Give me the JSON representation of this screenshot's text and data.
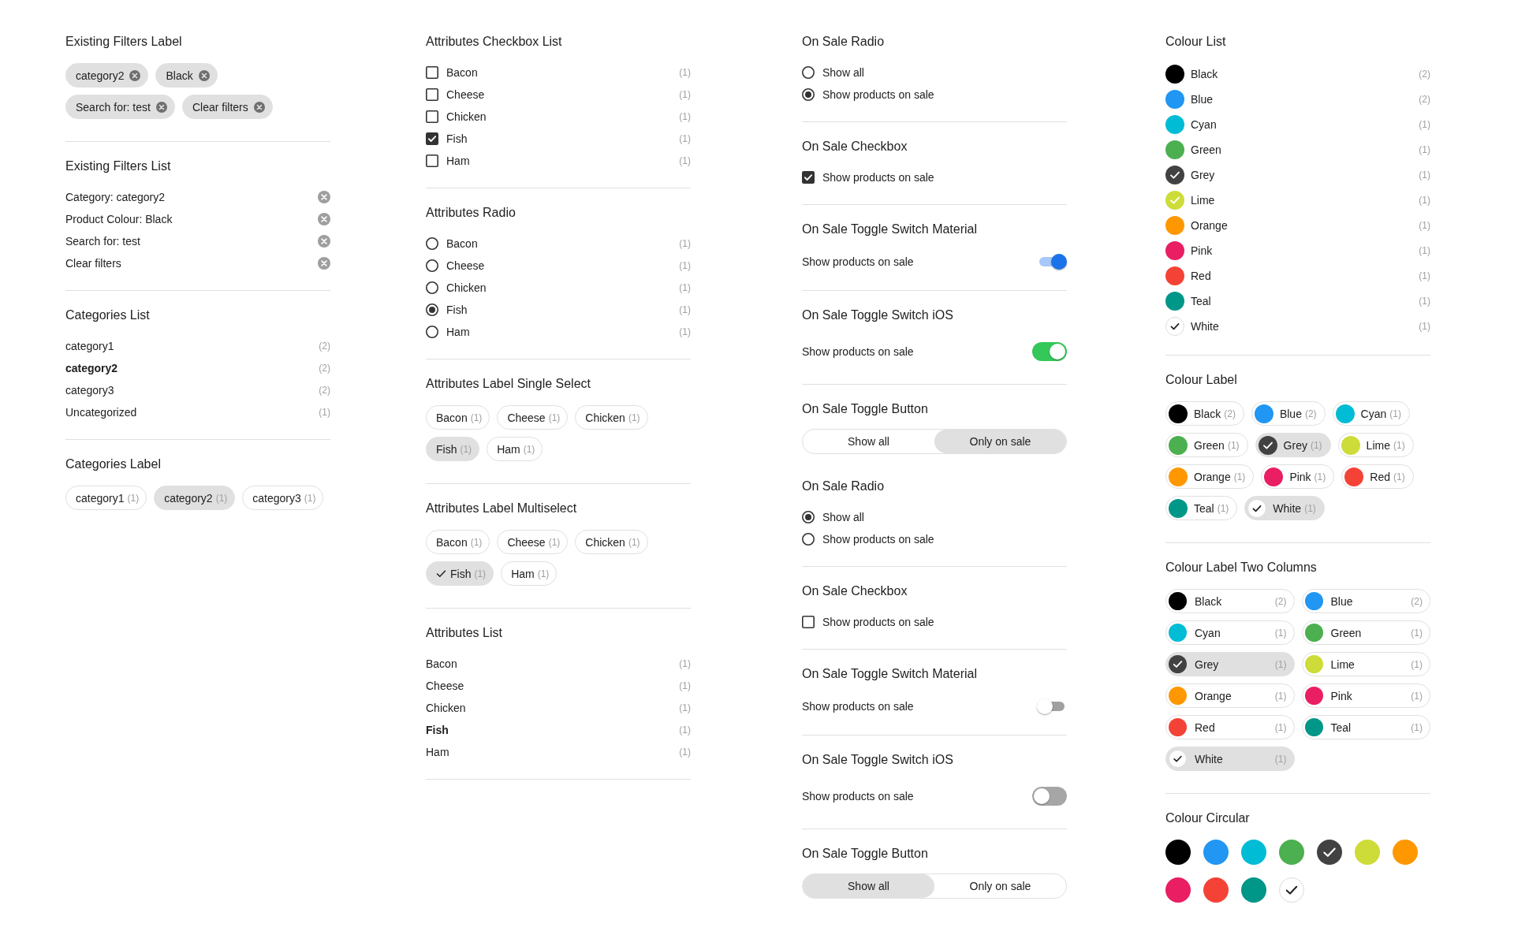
{
  "columns": [
    {
      "sections": [
        {
          "kind": "tags",
          "title": "Existing Filters Label",
          "divider": true,
          "chips": [
            {
              "label": "category2"
            },
            {
              "label": "Black"
            },
            {
              "label": "Search for: test"
            },
            {
              "label": "Clear filters"
            }
          ]
        },
        {
          "kind": "removals",
          "title": "Existing Filters List",
          "divider": true,
          "items": [
            {
              "label": "Category: category2"
            },
            {
              "label": "Product Colour: Black"
            },
            {
              "label": "Search for: test"
            },
            {
              "label": "Clear filters"
            }
          ]
        },
        {
          "kind": "links",
          "title": "Categories List",
          "divider": true,
          "items": [
            {
              "label": "category1",
              "count": "(2)",
              "selected": false
            },
            {
              "label": "category2",
              "count": "(2)",
              "selected": true
            },
            {
              "label": "category3",
              "count": "(2)",
              "selected": false
            },
            {
              "label": "Uncategorized",
              "count": "(1)",
              "selected": false
            }
          ]
        },
        {
          "kind": "pills",
          "title": "Categories Label",
          "divider": false,
          "chips": [
            {
              "label": "category1",
              "count": "(1)",
              "selected": false
            },
            {
              "label": "category2",
              "count": "(1)",
              "selected": true
            },
            {
              "label": "category3",
              "count": "(1)",
              "selected": false
            }
          ]
        }
      ]
    },
    {
      "sections": [
        {
          "kind": "checkboxes",
          "title": "Attributes Checkbox List",
          "divider": true,
          "items": [
            {
              "label": "Bacon",
              "count": "(1)",
              "checked": false
            },
            {
              "label": "Cheese",
              "count": "(1)",
              "checked": false
            },
            {
              "label": "Chicken",
              "count": "(1)",
              "checked": false
            },
            {
              "label": "Fish",
              "count": "(1)",
              "checked": true
            },
            {
              "label": "Ham",
              "count": "(1)",
              "checked": false
            }
          ]
        },
        {
          "kind": "radios",
          "title": "Attributes Radio",
          "divider": true,
          "items": [
            {
              "label": "Bacon",
              "count": "(1)",
              "selected": false
            },
            {
              "label": "Cheese",
              "count": "(1)",
              "selected": false
            },
            {
              "label": "Chicken",
              "count": "(1)",
              "selected": false
            },
            {
              "label": "Fish",
              "count": "(1)",
              "selected": true
            },
            {
              "label": "Ham",
              "count": "(1)",
              "selected": false
            }
          ]
        },
        {
          "kind": "pills",
          "title": "Attributes Label Single Select",
          "divider": true,
          "chips": [
            {
              "label": "Bacon",
              "count": "(1)",
              "selected": false
            },
            {
              "label": "Cheese",
              "count": "(1)",
              "selected": false
            },
            {
              "label": "Chicken",
              "count": "(1)",
              "selected": false
            },
            {
              "label": "Fish",
              "count": "(1)",
              "selected": true
            },
            {
              "label": "Ham",
              "count": "(1)",
              "selected": false
            }
          ]
        },
        {
          "kind": "checkpills",
          "title": "Attributes Label Multiselect",
          "divider": true,
          "chips": [
            {
              "label": "Bacon",
              "count": "(1)",
              "selected": false
            },
            {
              "label": "Cheese",
              "count": "(1)",
              "selected": false
            },
            {
              "label": "Chicken",
              "count": "(1)",
              "selected": false
            },
            {
              "label": "Fish",
              "count": "(1)",
              "selected": true
            },
            {
              "label": "Ham",
              "count": "(1)",
              "selected": false
            }
          ]
        },
        {
          "kind": "links",
          "title": "Attributes List",
          "divider": true,
          "items": [
            {
              "label": "Bacon",
              "count": "(1)",
              "selected": false
            },
            {
              "label": "Cheese",
              "count": "(1)",
              "selected": false
            },
            {
              "label": "Chicken",
              "count": "(1)",
              "selected": false
            },
            {
              "label": "Fish",
              "count": "(1)",
              "selected": true
            },
            {
              "label": "Ham",
              "count": "(1)",
              "selected": false
            }
          ]
        }
      ]
    },
    {
      "sections": [
        {
          "kind": "radios",
          "title": "On Sale Radio",
          "divider": true,
          "items": [
            {
              "label": "Show all",
              "selected": false
            },
            {
              "label": "Show products on sale",
              "selected": true
            }
          ]
        },
        {
          "kind": "checkboxes",
          "title": "On Sale Checkbox",
          "divider": true,
          "items": [
            {
              "label": "Show products on sale",
              "checked": true
            }
          ]
        },
        {
          "kind": "material",
          "title": "On Sale Toggle Switch Material",
          "divider": true,
          "label": "Show products on sale",
          "on": true
        },
        {
          "kind": "ios",
          "title": "On Sale Toggle Switch iOS",
          "divider": true,
          "label": "Show products on sale",
          "on": true
        },
        {
          "kind": "segments",
          "title": "On Sale Toggle Button",
          "divider": false,
          "options": [
            {
              "label": "Show all",
              "selected": false
            },
            {
              "label": "Only on sale",
              "selected": true
            }
          ]
        },
        {
          "kind": "radios",
          "title": "On Sale Radio",
          "divider": true,
          "items": [
            {
              "label": "Show all",
              "selected": true
            },
            {
              "label": "Show products on sale",
              "selected": false
            }
          ]
        },
        {
          "kind": "checkboxes",
          "title": "On Sale Checkbox",
          "divider": true,
          "items": [
            {
              "label": "Show products on sale",
              "checked": false
            }
          ]
        },
        {
          "kind": "material",
          "title": "On Sale Toggle Switch Material",
          "divider": true,
          "label": "Show products on sale",
          "on": false
        },
        {
          "kind": "ios",
          "title": "On Sale Toggle Switch iOS",
          "divider": true,
          "label": "Show products on sale",
          "on": false
        },
        {
          "kind": "segments",
          "title": "On Sale Toggle Button",
          "divider": false,
          "options": [
            {
              "label": "Show all",
              "selected": true
            },
            {
              "label": "Only on sale",
              "selected": false
            }
          ]
        }
      ]
    },
    {
      "sections": [
        {
          "kind": "swatchlist",
          "title": "Colour List",
          "divider": true,
          "items": [
            {
              "label": "Black",
              "count": "(2)",
              "color": "#000000",
              "selected": false
            },
            {
              "label": "Blue",
              "count": "(2)",
              "color": "#2196f3",
              "selected": false
            },
            {
              "label": "Cyan",
              "count": "(1)",
              "color": "#00bcd4",
              "selected": false
            },
            {
              "label": "Green",
              "count": "(1)",
              "color": "#4caf50",
              "selected": false
            },
            {
              "label": "Grey",
              "count": "(1)",
              "color": "#424242",
              "selected": true
            },
            {
              "label": "Lime",
              "count": "(1)",
              "color": "#cddc39",
              "selected": true
            },
            {
              "label": "Orange",
              "count": "(1)",
              "color": "#ff9800",
              "selected": false
            },
            {
              "label": "Pink",
              "count": "(1)",
              "color": "#e91e63",
              "selected": false
            },
            {
              "label": "Red",
              "count": "(1)",
              "color": "#f44336",
              "selected": false
            },
            {
              "label": "Teal",
              "count": "(1)",
              "color": "#009688",
              "selected": false
            },
            {
              "label": "White",
              "count": "(1)",
              "color": "#ffffff",
              "selected": true
            }
          ]
        },
        {
          "kind": "swatchpills",
          "title": "Colour Label",
          "divider": true,
          "chips": [
            {
              "label": "Black",
              "count": "(2)",
              "color": "#000000",
              "selected": false
            },
            {
              "label": "Blue",
              "count": "(2)",
              "color": "#2196f3",
              "selected": false
            },
            {
              "label": "Cyan",
              "count": "(1)",
              "color": "#00bcd4",
              "selected": false
            },
            {
              "label": "Green",
              "count": "(1)",
              "color": "#4caf50",
              "selected": false
            },
            {
              "label": "Grey",
              "count": "(1)",
              "color": "#424242",
              "selected": true
            },
            {
              "label": "Lime",
              "count": "(1)",
              "color": "#cddc39",
              "selected": false
            },
            {
              "label": "Orange",
              "count": "(1)",
              "color": "#ff9800",
              "selected": false
            },
            {
              "label": "Pink",
              "count": "(1)",
              "color": "#e91e63",
              "selected": false
            },
            {
              "label": "Red",
              "count": "(1)",
              "color": "#f44336",
              "selected": false
            },
            {
              "label": "Teal",
              "count": "(1)",
              "color": "#009688",
              "selected": false
            },
            {
              "label": "White",
              "count": "(1)",
              "color": "#ffffff",
              "selected": true
            }
          ]
        },
        {
          "kind": "swatchgrid",
          "title": "Colour Label Two Columns",
          "divider": true,
          "chips": [
            {
              "label": "Black",
              "count": "(2)",
              "color": "#000000",
              "selected": false
            },
            {
              "label": "Blue",
              "count": "(2)",
              "color": "#2196f3",
              "selected": false
            },
            {
              "label": "Cyan",
              "count": "(1)",
              "color": "#00bcd4",
              "selected": false
            },
            {
              "label": "Green",
              "count": "(1)",
              "color": "#4caf50",
              "selected": false
            },
            {
              "label": "Grey",
              "count": "(1)",
              "color": "#424242",
              "selected": true
            },
            {
              "label": "Lime",
              "count": "(1)",
              "color": "#cddc39",
              "selected": false
            },
            {
              "label": "Orange",
              "count": "(1)",
              "color": "#ff9800",
              "selected": false
            },
            {
              "label": "Pink",
              "count": "(1)",
              "color": "#e91e63",
              "selected": false
            },
            {
              "label": "Red",
              "count": "(1)",
              "color": "#f44336",
              "selected": false
            },
            {
              "label": "Teal",
              "count": "(1)",
              "color": "#009688",
              "selected": false
            },
            {
              "label": "White",
              "count": "(1)",
              "color": "#ffffff",
              "selected": true
            }
          ]
        },
        {
          "kind": "swatches",
          "title": "Colour Circular",
          "divider": false,
          "items": [
            {
              "color": "#000000",
              "selected": false
            },
            {
              "color": "#2196f3",
              "selected": false
            },
            {
              "color": "#00bcd4",
              "selected": false
            },
            {
              "color": "#4caf50",
              "selected": false
            },
            {
              "color": "#424242",
              "selected": true
            },
            {
              "color": "#cddc39",
              "selected": false
            },
            {
              "color": "#ff9800",
              "selected": false
            },
            {
              "color": "#e91e63",
              "selected": false
            },
            {
              "color": "#f44336",
              "selected": false
            },
            {
              "color": "#009688",
              "selected": false
            },
            {
              "color": "#ffffff",
              "selected": true
            }
          ]
        }
      ]
    }
  ]
}
